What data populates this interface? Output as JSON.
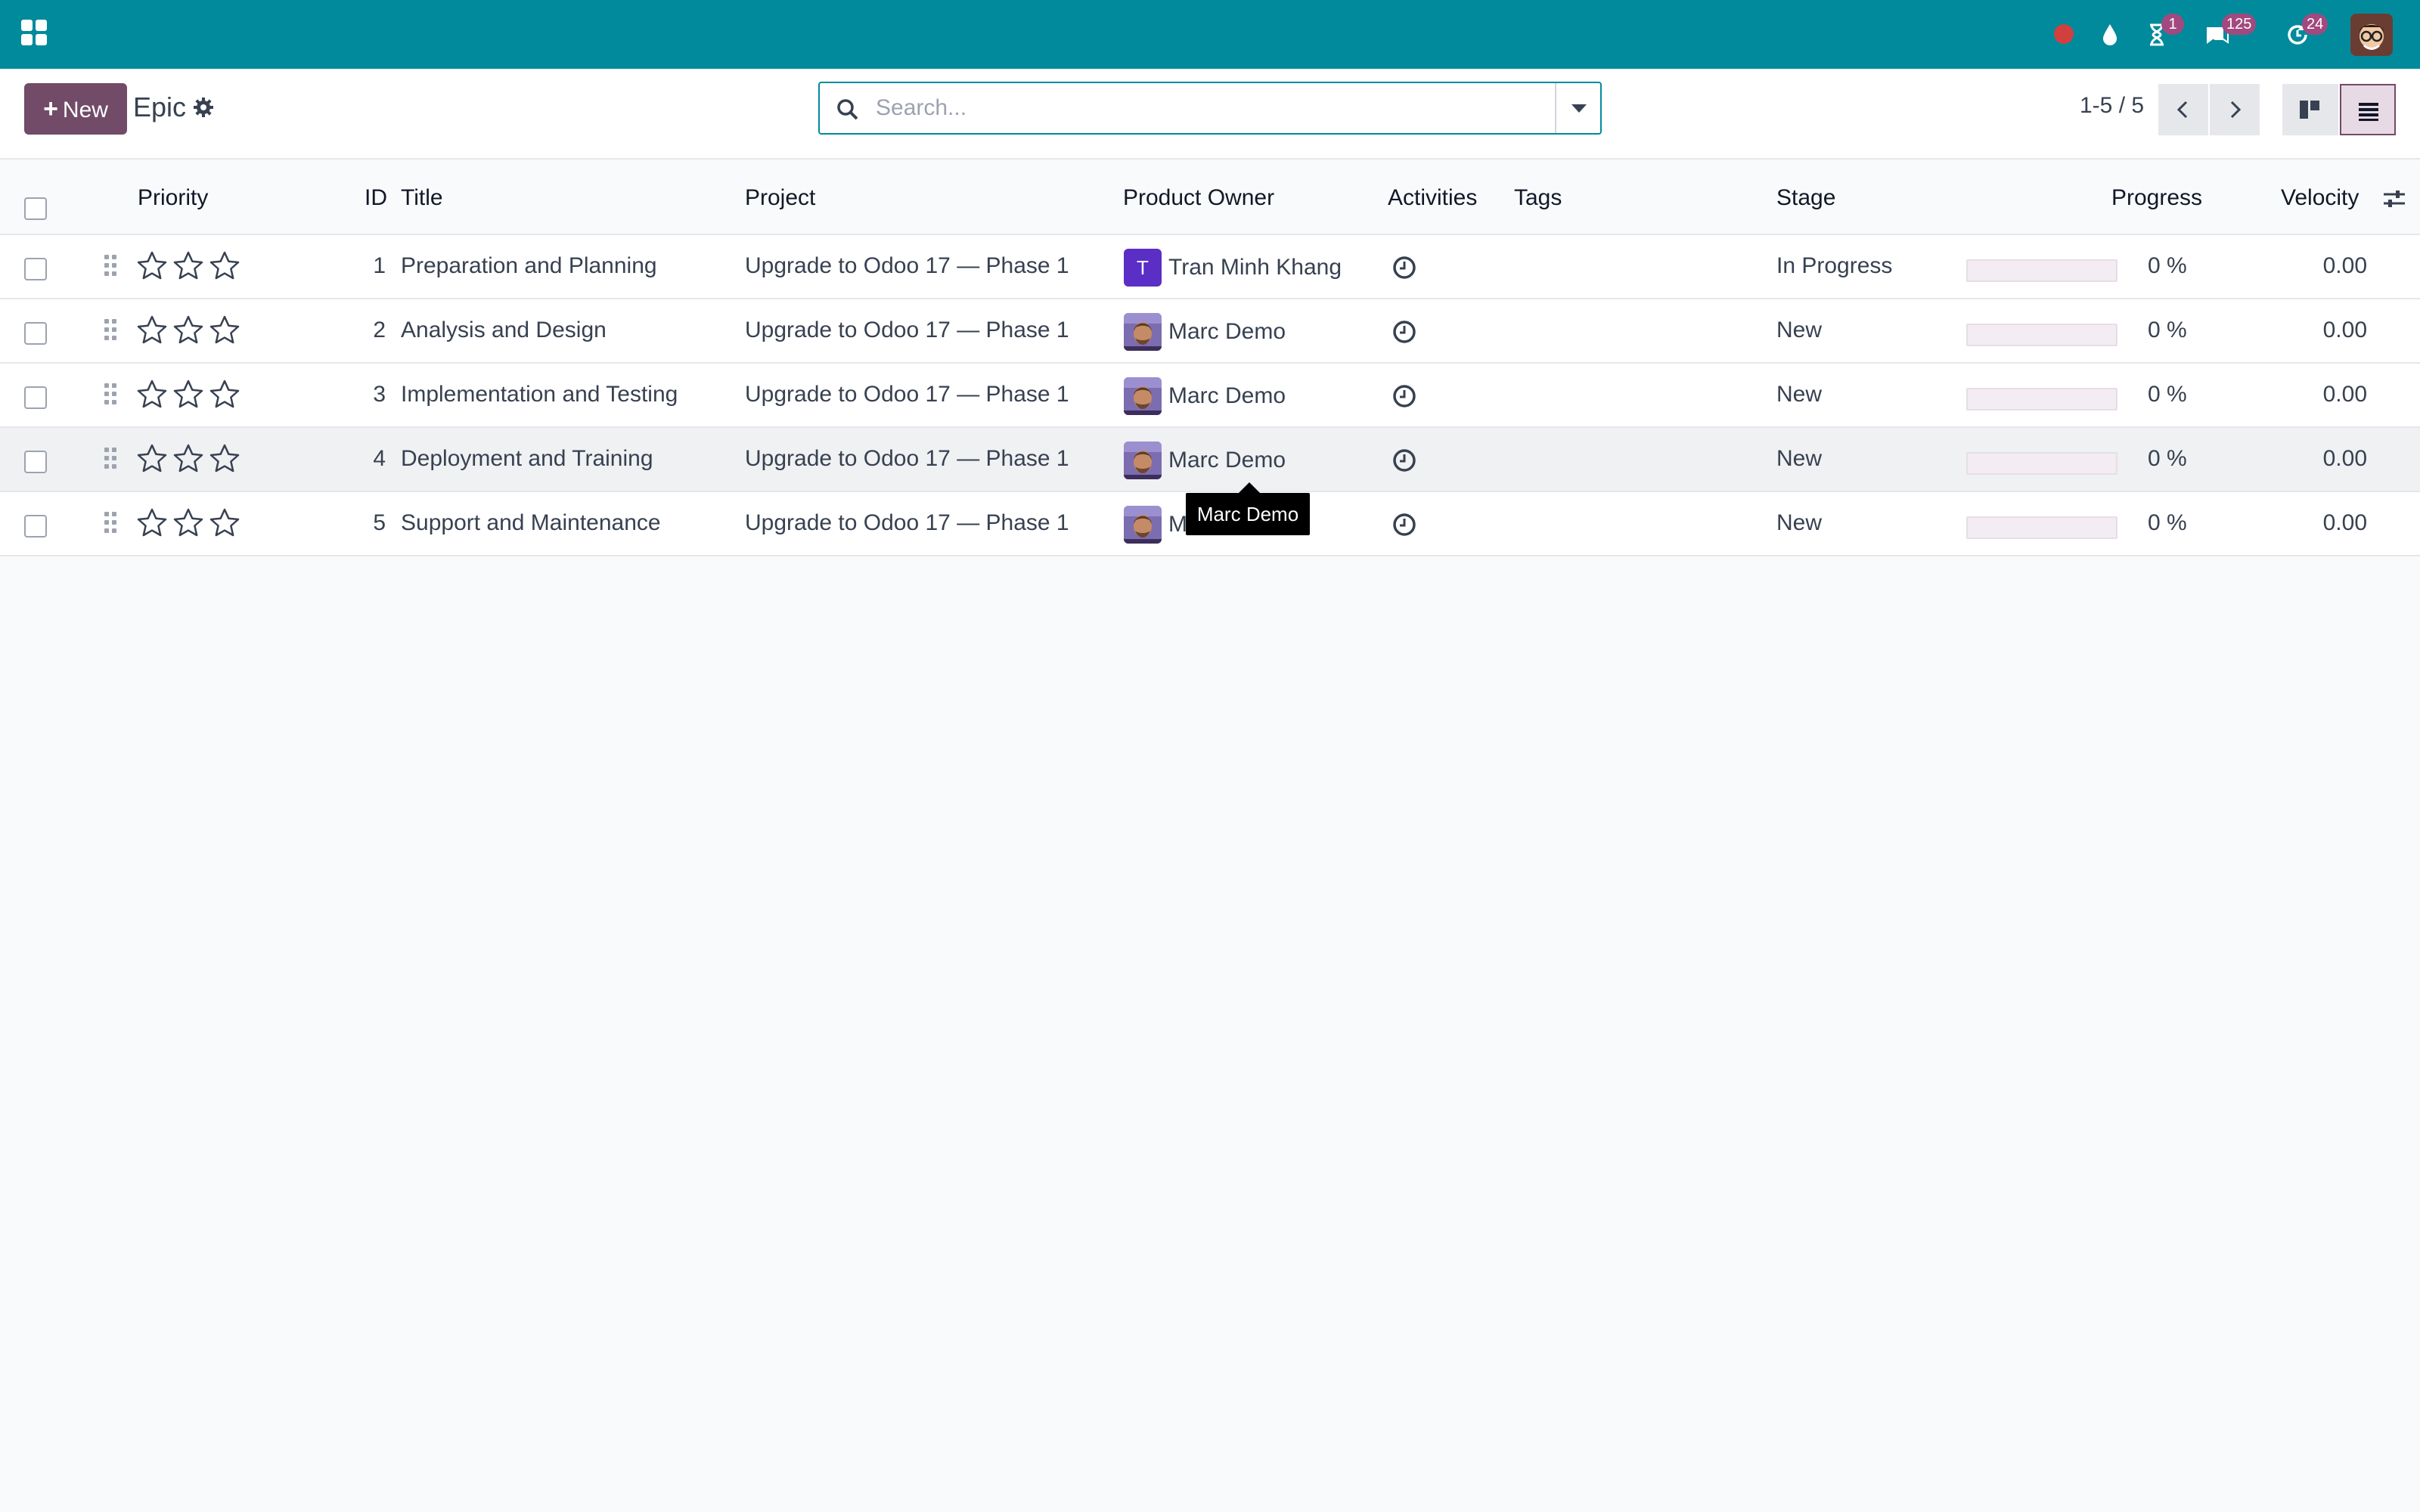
{
  "navbar": {
    "apps_icon": "grid-icon",
    "systray": [
      {
        "name": "record-dot",
        "color": "#d23f3f"
      },
      {
        "name": "drop-icon",
        "badge": ""
      },
      {
        "name": "hourglass-icon",
        "badge": "1"
      },
      {
        "name": "chat-icon",
        "badge": "125"
      },
      {
        "name": "refresh-clock-icon",
        "badge": "24"
      }
    ],
    "accent_color": "#018a9c"
  },
  "control": {
    "new_button": "New",
    "breadcrumb": "Epic",
    "search_placeholder": "Search...",
    "pager": "1-5 / 5"
  },
  "list": {
    "columns": [
      "Priority",
      "ID",
      "Title",
      "Project",
      "Product Owner",
      "Activities",
      "Tags",
      "Stage",
      "Progress",
      "Velocity"
    ],
    "rows": [
      {
        "id": "1",
        "title": "Preparation and Planning",
        "project": "Upgrade to Odoo 17 — Phase 1",
        "owner": "Tran Minh Khang",
        "owner_initial": "T",
        "stage": "In Progress",
        "progress": 0,
        "progress_label": "0 %",
        "velocity": "0.00"
      },
      {
        "id": "2",
        "title": "Analysis and Design",
        "project": "Upgrade to Odoo 17 — Phase 1",
        "owner": "Marc Demo",
        "owner_initial": "",
        "stage": "New",
        "progress": 0,
        "progress_label": "0 %",
        "velocity": "0.00"
      },
      {
        "id": "3",
        "title": "Implementation and Testing",
        "project": "Upgrade to Odoo 17 — Phase 1",
        "owner": "Marc Demo",
        "owner_initial": "",
        "stage": "New",
        "progress": 0,
        "progress_label": "0 %",
        "velocity": "0.00"
      },
      {
        "id": "4",
        "title": "Deployment and Training",
        "project": "Upgrade to Odoo 17 — Phase 1",
        "owner": "Marc Demo",
        "owner_initial": "",
        "stage": "New",
        "progress": 0,
        "progress_label": "0 %",
        "velocity": "0.00"
      },
      {
        "id": "5",
        "title": "Support and Maintenance",
        "project": "Upgrade to Odoo 17 — Phase 1",
        "owner": "M",
        "owner_initial": "",
        "stage": "New",
        "progress": 0,
        "progress_label": "0 %",
        "velocity": "0.00"
      }
    ]
  },
  "tooltip": "Marc Demo"
}
